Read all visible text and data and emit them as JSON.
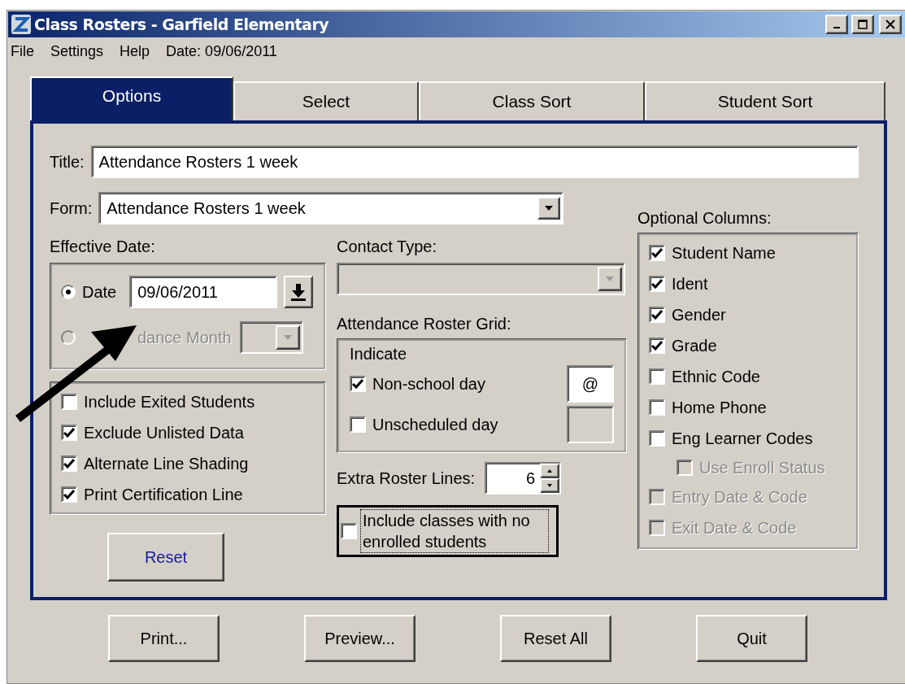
{
  "window": {
    "title": "Class Rosters - Garfield Elementary"
  },
  "menu": [
    {
      "label": "File"
    },
    {
      "label": "Settings"
    },
    {
      "label": "Help"
    }
  ],
  "menu_date": "Date: 09/06/2011",
  "tabs": [
    {
      "label": "Options",
      "selected": true
    },
    {
      "label": "Select",
      "selected": false
    },
    {
      "label": "Class Sort",
      "selected": false
    },
    {
      "label": "Student Sort",
      "selected": false
    }
  ],
  "title_field": {
    "label": "Title:",
    "value": "Attendance Rosters 1 week"
  },
  "form_field": {
    "label": "Form:",
    "value": "Attendance Rosters 1 week"
  },
  "effective_date": {
    "label": "Effective Date:",
    "options": [
      {
        "kind": "date",
        "label": "Date",
        "selected": true,
        "disabled": false,
        "value": "09/06/2011"
      },
      {
        "kind": "month",
        "label": "dance Month",
        "selected": false,
        "disabled": true
      }
    ]
  },
  "options": [
    {
      "label": "Include Exited Students",
      "checked": false
    },
    {
      "label": "Exclude Unlisted Data",
      "checked": true
    },
    {
      "label": "Alternate Line Shading",
      "checked": true
    },
    {
      "label": "Print Certification Line",
      "checked": true
    }
  ],
  "reset_button": {
    "label": "Reset"
  },
  "contact_type": {
    "label": "Contact Type:",
    "disabled": true
  },
  "roster_grid": {
    "label": "Attendance Roster Grid:",
    "heading": "Indicate",
    "rows": [
      {
        "label": "Non-school day",
        "checked": true,
        "symbol": "@"
      },
      {
        "label": "Unscheduled day",
        "checked": false
      }
    ]
  },
  "extra_lines": {
    "label": "Extra Roster Lines:",
    "value": "6"
  },
  "include_empty": {
    "label": "Include classes with no enrolled students",
    "checked": false,
    "focused": true
  },
  "optional_columns": {
    "label": "Optional Columns:",
    "items": [
      {
        "label": "Student Name",
        "checked": true,
        "disabled": false
      },
      {
        "label": "Ident",
        "checked": true,
        "disabled": false
      },
      {
        "label": "Gender",
        "checked": true,
        "disabled": false
      },
      {
        "label": "Grade",
        "checked": true,
        "disabled": false
      },
      {
        "label": "Ethnic Code",
        "checked": false,
        "disabled": false
      },
      {
        "label": "Home Phone",
        "checked": false,
        "disabled": false
      },
      {
        "label": "Eng Learner Codes",
        "checked": false,
        "disabled": false,
        "children": [
          {
            "label": "Use Enroll Status",
            "checked": false,
            "disabled": true
          }
        ]
      },
      {
        "label": "Entry Date & Code",
        "checked": false,
        "disabled": true
      },
      {
        "label": "Exit Date & Code",
        "checked": false,
        "disabled": true
      }
    ]
  },
  "buttons": [
    {
      "label": "Print..."
    },
    {
      "label": "Preview..."
    },
    {
      "label": "Reset All"
    },
    {
      "label": "Quit"
    }
  ]
}
